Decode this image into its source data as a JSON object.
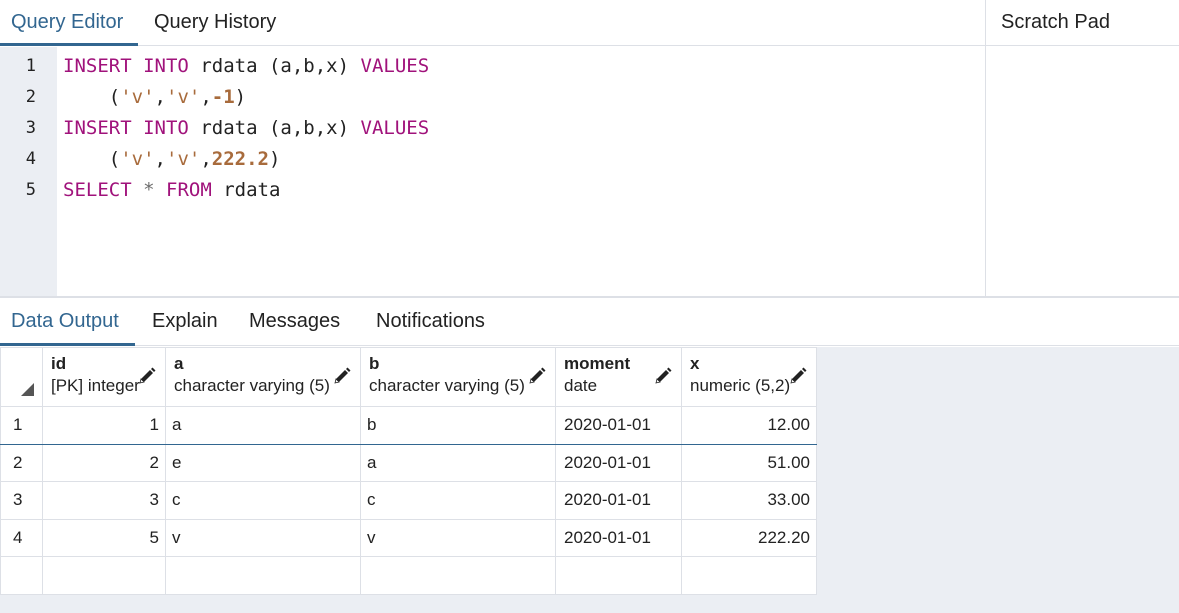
{
  "editor": {
    "tabs": [
      {
        "label": "Query Editor",
        "active": true
      },
      {
        "label": "Query History",
        "active": false
      }
    ],
    "scratch_pad_label": "Scratch Pad",
    "line_numbers": [
      "1",
      "2",
      "3",
      "4",
      "5"
    ],
    "lines": [
      {
        "kw1": "INSERT",
        "kw2": "INTO",
        "ident": "rdata",
        "cols": "(a,b,x)",
        "kw3": "VALUES"
      },
      {
        "open": "(",
        "s1": "'v'",
        "c1": ",",
        "s2": "'v'",
        "c2": ",",
        "num": "-1",
        "close": ")"
      },
      {
        "kw1": "INSERT",
        "kw2": "INTO",
        "ident": "rdata",
        "cols": "(a,b,x)",
        "kw3": "VALUES"
      },
      {
        "open": "(",
        "s1": "'v'",
        "c1": ",",
        "s2": "'v'",
        "c2": ",",
        "num": "222.2",
        "close": ")"
      },
      {
        "kw1": "SELECT",
        "star": "*",
        "kw2": "FROM",
        "ident": "rdata"
      }
    ],
    "colors": {
      "keyword": "#a0127b",
      "string": "#a86b3c",
      "accent": "#326690"
    }
  },
  "output": {
    "tabs": [
      {
        "label": "Data Output",
        "active": true
      },
      {
        "label": "Explain",
        "active": false
      },
      {
        "label": "Messages",
        "active": false
      },
      {
        "label": "Notifications",
        "active": false
      }
    ],
    "columns": [
      {
        "name": "id",
        "type": "[PK] integer",
        "edit_icon": "pencil-icon"
      },
      {
        "name": "a",
        "type": "character varying (5)",
        "edit_icon": "pencil-icon"
      },
      {
        "name": "b",
        "type": "character varying (5)",
        "edit_icon": "pencil-icon"
      },
      {
        "name": "moment",
        "type": "date",
        "edit_icon": "pencil-icon"
      },
      {
        "name": "x",
        "type": "numeric (5,2)",
        "edit_icon": "pencil-icon"
      }
    ],
    "rows": [
      {
        "num": "1",
        "id": "1",
        "a": "a",
        "b": "b",
        "moment": "2020-01-01",
        "x": "12.00"
      },
      {
        "num": "2",
        "id": "2",
        "a": "e",
        "b": "a",
        "moment": "2020-01-01",
        "x": "51.00"
      },
      {
        "num": "3",
        "id": "3",
        "a": "c",
        "b": "c",
        "moment": "2020-01-01",
        "x": "33.00"
      },
      {
        "num": "4",
        "id": "5",
        "a": "v",
        "b": "v",
        "moment": "2020-01-01",
        "x": "222.20"
      }
    ]
  }
}
